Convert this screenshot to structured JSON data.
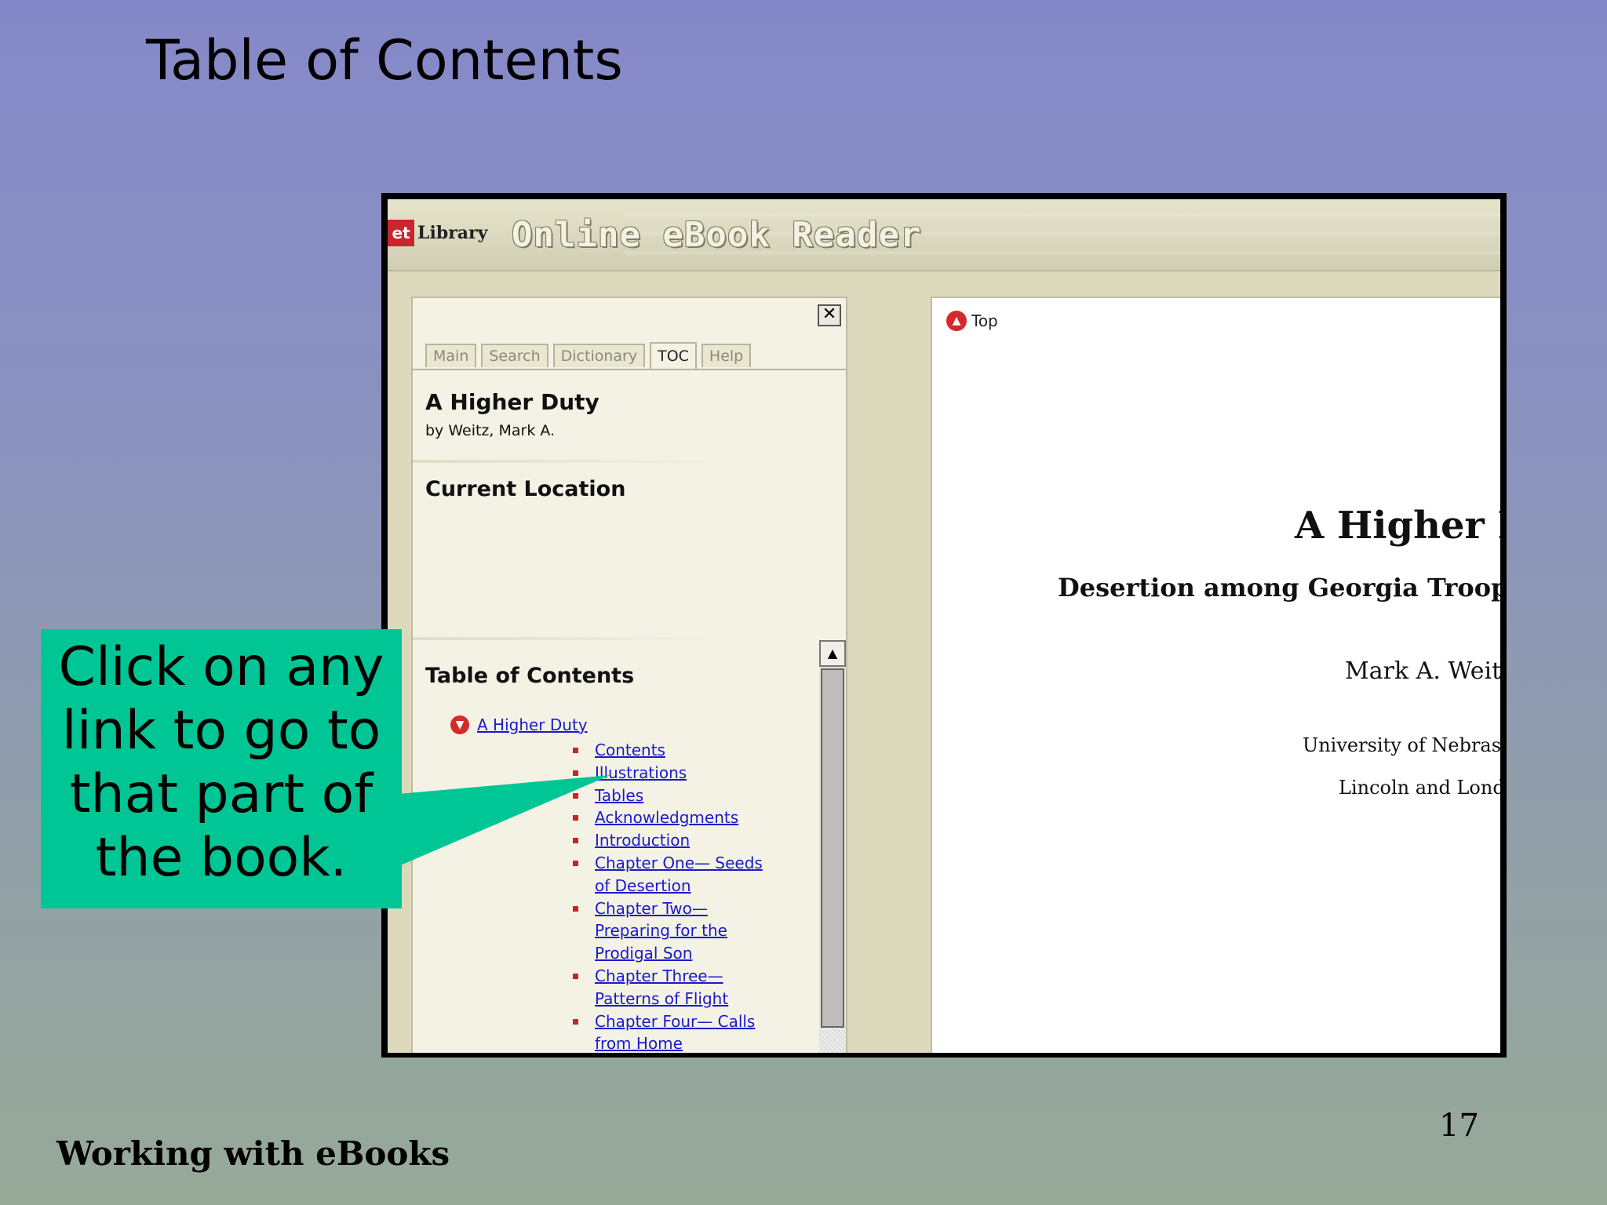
{
  "slide": {
    "title": "Table of Contents",
    "footer": "Working with eBooks",
    "page_number": "17",
    "callout_lines": [
      "Click on any",
      "link to go to",
      "that part of",
      "the book."
    ]
  },
  "app": {
    "logo_mark": "et",
    "logo_text": "Library",
    "title": "Online eBook Reader"
  },
  "sidebar": {
    "close_glyph": "✕",
    "tabs": [
      {
        "label": "Main",
        "active": false
      },
      {
        "label": "Search",
        "active": false
      },
      {
        "label": "Dictionary",
        "active": false
      },
      {
        "label": "TOC",
        "active": true
      },
      {
        "label": "Help",
        "active": false
      }
    ],
    "book_title": "A Higher Duty",
    "book_author": "by Weitz, Mark A.",
    "current_location_heading": "Current Location",
    "toc_heading": "Table of Contents",
    "toc_root": "A Higher Duty",
    "toc_items": [
      [
        "Contents"
      ],
      [
        "Illustrations"
      ],
      [
        "Tables"
      ],
      [
        "Acknowledgments"
      ],
      [
        "Introduction"
      ],
      [
        "Chapter One— Seeds",
        "of Desertion"
      ],
      [
        "Chapter Two—",
        "Preparing for the",
        "Prodigal Son"
      ],
      [
        "Chapter Three—",
        "Patterns of Flight"
      ],
      [
        "Chapter Four— Calls",
        "from Home"
      ]
    ]
  },
  "reader": {
    "top_label": "Top",
    "title": "A Higher D",
    "subtitle": "Desertion among Georgia Troops",
    "author": "Mark A. Weitz",
    "publisher_line1": "University of Nebraska",
    "publisher_line2": "Lincoln and Londo"
  },
  "colors": {
    "callout": "#00c696",
    "link": "#1a1acc",
    "bullet": "#cc2222"
  }
}
